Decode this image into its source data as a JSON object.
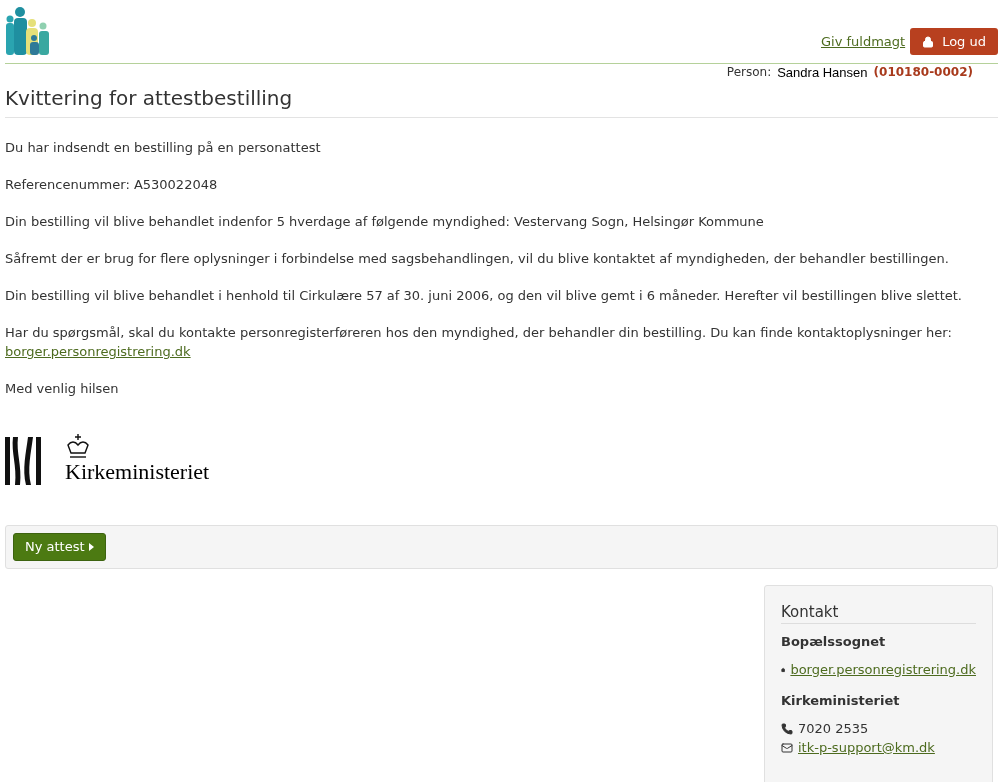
{
  "header": {
    "proxy_link": "Giv fuldmagt",
    "logout_button": "Log ud",
    "person_label": "Person:",
    "person_name": "Sandra Hansen",
    "person_id": "(010180-0002)"
  },
  "title": "Kvittering for attestbestilling",
  "paragraphs": [
    {
      "text": "Du har indsendt en bestilling på en personattest"
    },
    {
      "text": "Referencenummer: A530022048"
    },
    {
      "text": "Din bestilling vil blive behandlet indenfor 5 hverdage af følgende myndighed: Vestervang Sogn, Helsingør Kommune"
    },
    {
      "text": "Såfremt der er brug for flere oplysninger i forbindelse med sagsbehandlingen, vil du blive kontaktet af myndigheden, der behandler bestillingen."
    },
    {
      "text": "Din bestilling vil blive behandlet i henhold til Cirkulære 57 af 30. juni 2006, og den vil blive gemt i 6 måneder. Herefter vil bestillingen blive slettet."
    },
    {
      "text": "Har du spørgsmål, skal du kontakte personregisterføreren hos den myndighed, der behandler din bestilling. Du kan finde kontaktoplysninger her:",
      "link": "borger.personregistrering.dk"
    },
    {
      "text": "Med venlig hilsen"
    }
  ],
  "ministry_logo": {
    "name": "Kirkeministeriet"
  },
  "action_button": "Ny attest",
  "contact": {
    "title": "Kontakt",
    "groups": [
      {
        "heading": "Bopælssognet",
        "items": [
          {
            "kind": "web",
            "text": "borger.personregistrering.dk"
          }
        ]
      },
      {
        "heading": "Kirkeministeriet",
        "items": [
          {
            "kind": "phone",
            "text": "7020 2535"
          },
          {
            "kind": "email",
            "text": "itk-p-support@km.dk"
          }
        ]
      }
    ]
  }
}
